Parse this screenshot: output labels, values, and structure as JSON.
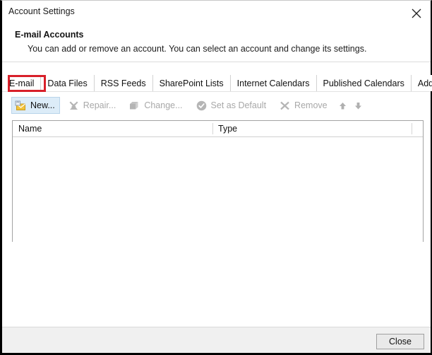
{
  "window": {
    "title": "Account Settings",
    "close_icon": "close-icon"
  },
  "header": {
    "title": "E-mail Accounts",
    "description": "You can add or remove an account. You can select an account and change its settings."
  },
  "tabs": [
    {
      "label": "E-mail",
      "selected": true,
      "highlighted": true
    },
    {
      "label": "Data Files",
      "selected": false,
      "highlighted": false
    },
    {
      "label": "RSS Feeds",
      "selected": false,
      "highlighted": false
    },
    {
      "label": "SharePoint Lists",
      "selected": false,
      "highlighted": false
    },
    {
      "label": "Internet Calendars",
      "selected": false,
      "highlighted": false
    },
    {
      "label": "Published Calendars",
      "selected": false,
      "highlighted": false
    },
    {
      "label": "Address Books",
      "selected": false,
      "highlighted": false
    }
  ],
  "toolbar": {
    "buttons": [
      {
        "label": "New...",
        "icon": "new-account-icon",
        "enabled": true
      },
      {
        "label": "Repair...",
        "icon": "repair-wrench-icon",
        "enabled": false
      },
      {
        "label": "Change...",
        "icon": "change-icon",
        "enabled": false
      },
      {
        "label": "Set as Default",
        "icon": "check-circle-icon",
        "enabled": false
      },
      {
        "label": "Remove",
        "icon": "x-mark-icon",
        "enabled": false
      }
    ],
    "move_up_icon": "arrow-up-icon",
    "move_down_icon": "arrow-down-icon"
  },
  "account_list": {
    "columns": [
      {
        "label": "Name"
      },
      {
        "label": "Type"
      }
    ],
    "rows": []
  },
  "footer": {
    "close_label": "Close"
  },
  "colors": {
    "highlight_box": "#d8202a",
    "enabled_button_bg": "#dcecf8",
    "disabled_text": "#a8a8a8",
    "footer_bg": "#f0f0f0"
  }
}
